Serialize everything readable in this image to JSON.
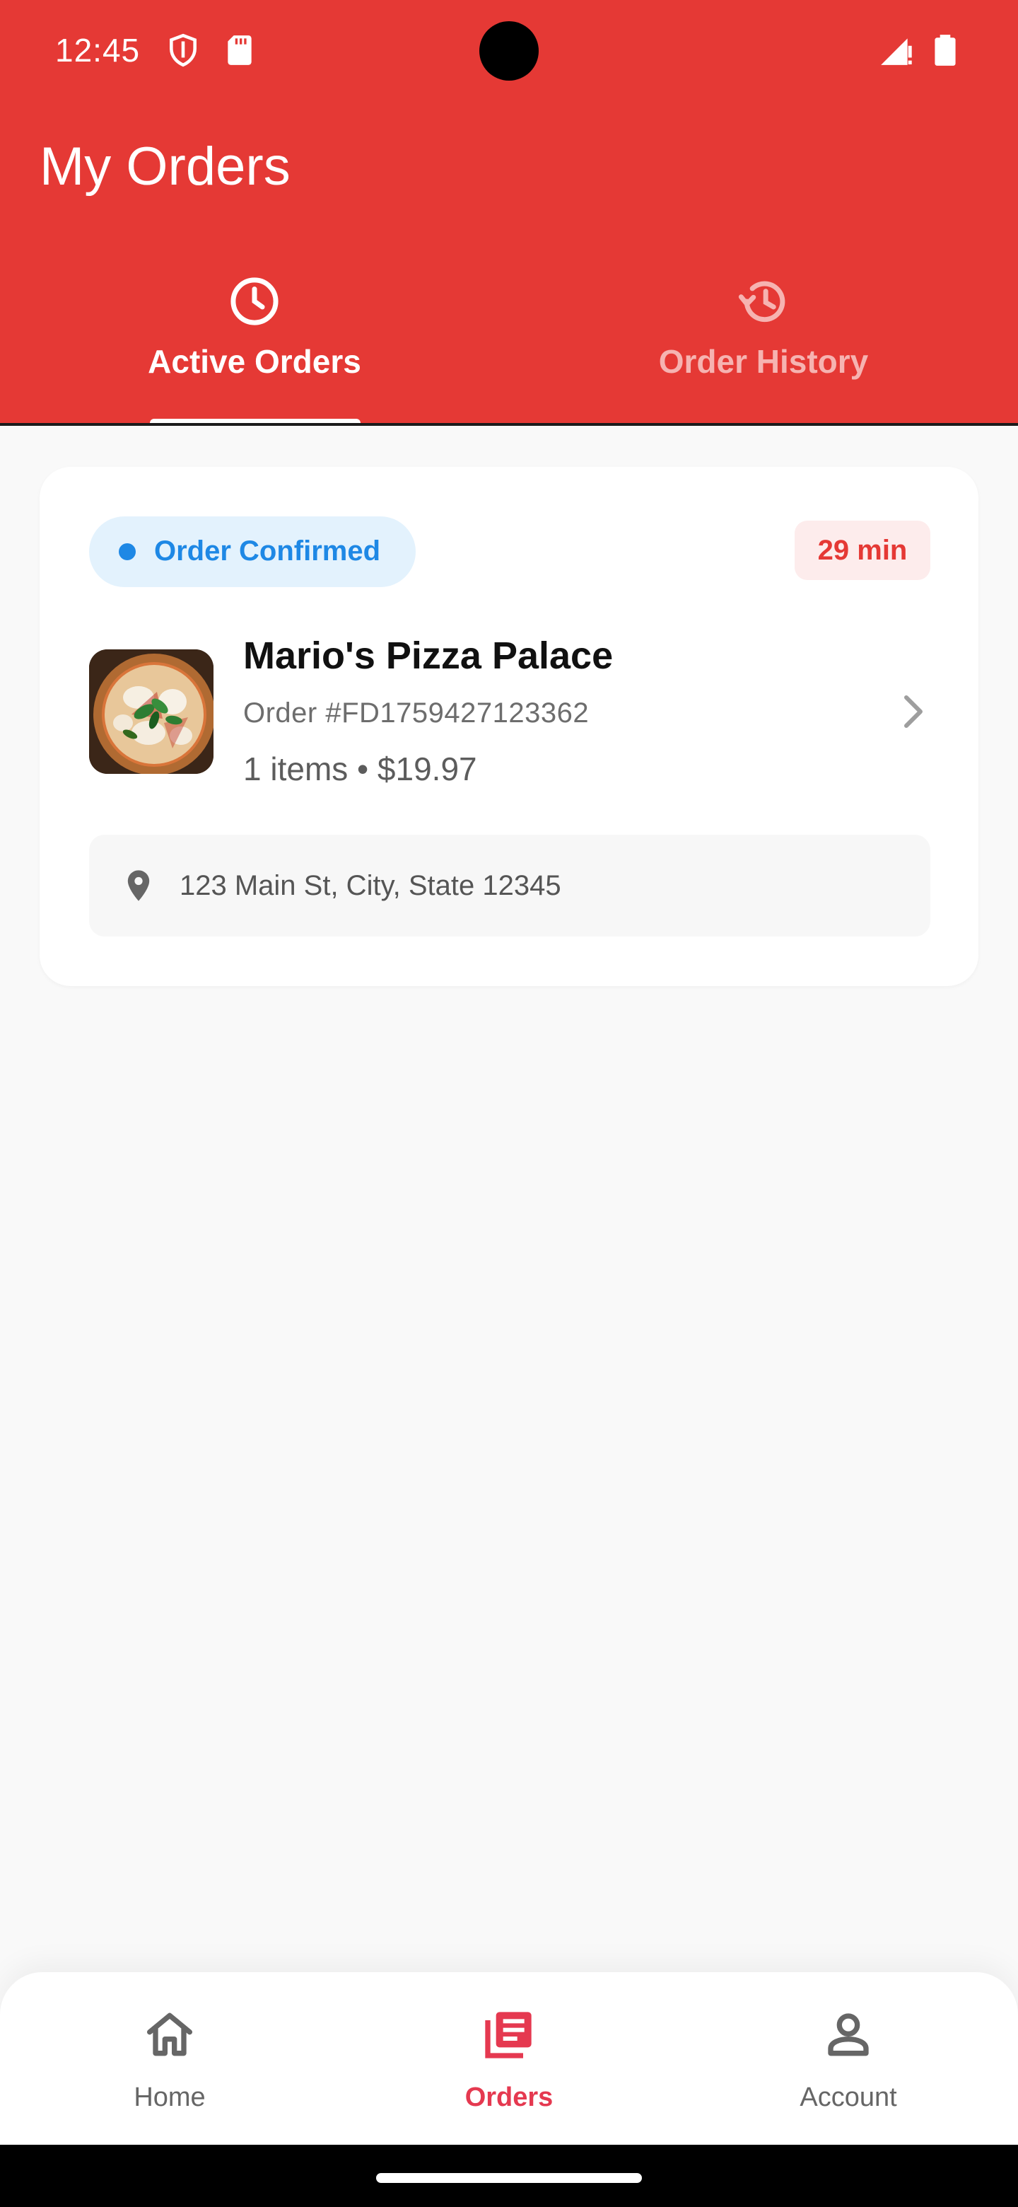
{
  "status_bar": {
    "time": "12:45"
  },
  "header": {
    "title": "My Orders",
    "tabs": [
      {
        "label": "Active Orders",
        "icon": "clock-icon",
        "active": true
      },
      {
        "label": "Order History",
        "icon": "history-icon",
        "active": false
      }
    ]
  },
  "order": {
    "status": "Order Confirmed",
    "eta": "29 min",
    "restaurant": "Mario's Pizza Palace",
    "order_number": "Order #FD1759427123362",
    "summary": "1 items • $19.97",
    "address": "123 Main St, City, State 12345"
  },
  "bottom_nav": {
    "items": [
      {
        "label": "Home",
        "icon": "home-icon",
        "active": false
      },
      {
        "label": "Orders",
        "icon": "orders-icon",
        "active": true
      },
      {
        "label": "Account",
        "icon": "account-icon",
        "active": false
      }
    ]
  },
  "colors": {
    "primary": "#e53935",
    "status_blue": "#1e88e5",
    "status_blue_bg": "#e3f2fd",
    "nav_active": "#e53950",
    "background": "#f9f9f9"
  }
}
